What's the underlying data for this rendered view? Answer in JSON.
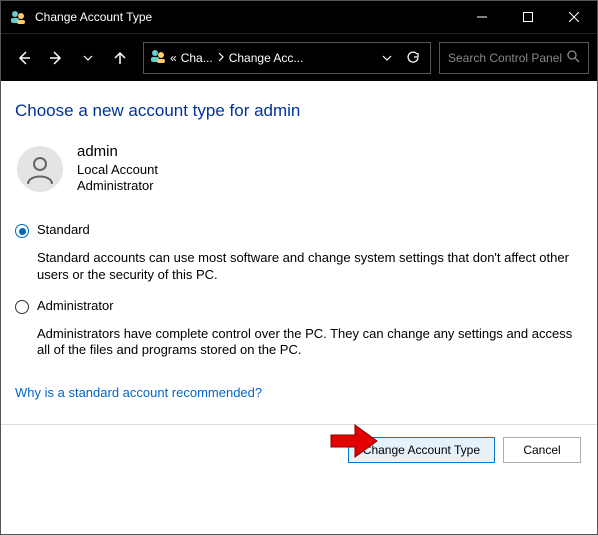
{
  "window": {
    "title": "Change Account Type"
  },
  "breadcrumb": {
    "prefix": "«",
    "seg1": "Cha...",
    "seg2": "Change Acc..."
  },
  "search": {
    "placeholder": "Search Control Panel"
  },
  "page": {
    "heading": "Choose a new account type for admin"
  },
  "user": {
    "name": "admin",
    "type": "Local Account",
    "role": "Administrator"
  },
  "options": {
    "standard": {
      "label": "Standard",
      "description": "Standard accounts can use most software and change system settings that don't affect other users or the security of this PC.",
      "selected": true
    },
    "administrator": {
      "label": "Administrator",
      "description": "Administrators have complete control over the PC. They can change any settings and access all of the files and programs stored on the PC.",
      "selected": false
    }
  },
  "links": {
    "why_standard": "Why is a standard account recommended?"
  },
  "buttons": {
    "change": "Change Account Type",
    "cancel": "Cancel"
  }
}
